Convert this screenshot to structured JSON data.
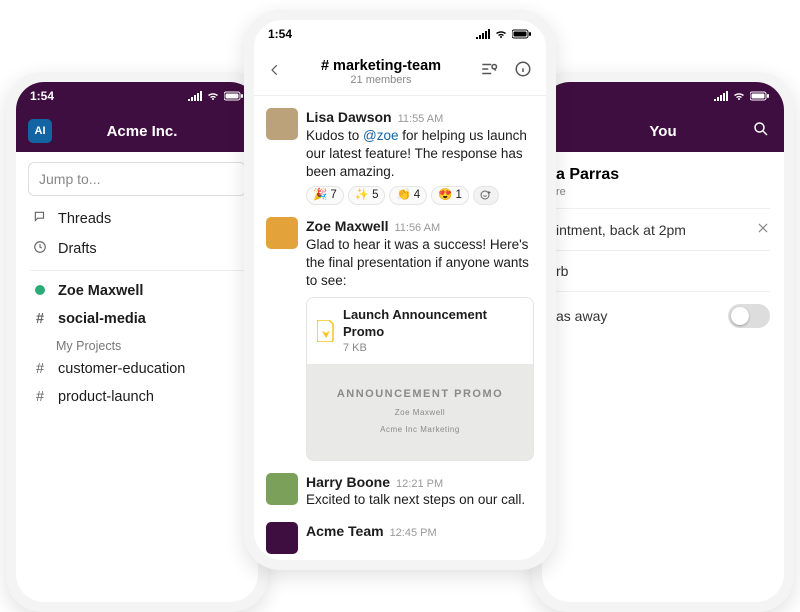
{
  "status": {
    "time": "1:54"
  },
  "left": {
    "workspace_icon_text": "AI",
    "workspace_name": "Acme Inc.",
    "search_placeholder": "Jump to...",
    "nav": {
      "threads": "Threads",
      "drafts": "Drafts"
    },
    "items": [
      {
        "label": "Zoe Maxwell",
        "kind": "dm",
        "bold": true
      },
      {
        "label": "social-media",
        "kind": "channel",
        "bold": true
      }
    ],
    "section_heading": "My Projects",
    "items2": [
      {
        "label": "customer-education",
        "kind": "channel",
        "bold": false
      },
      {
        "label": "product-launch",
        "kind": "channel",
        "bold": false
      }
    ]
  },
  "right": {
    "header": "You",
    "user_name_fragment": "a Parras",
    "rows": {
      "status_text": "intment, back at 2pm",
      "edit_text": "rb",
      "away_label": "as away"
    }
  },
  "center": {
    "channel": "# marketing-team",
    "members": "21 members",
    "messages": [
      {
        "author": "Lisa Dawson",
        "time": "11:55 AM",
        "avatar_color": "#bba27a",
        "text_before": "Kudos to ",
        "mention": "@zoe",
        "text_after": " for helping us launch our latest feature! The response has been amazing.",
        "reactions": [
          {
            "emoji": "🎉",
            "count": "7"
          },
          {
            "emoji": "✨",
            "count": "5"
          },
          {
            "emoji": "👏",
            "count": "4"
          },
          {
            "emoji": "😍",
            "count": "1"
          }
        ]
      },
      {
        "author": "Zoe Maxwell",
        "time": "11:56 AM",
        "avatar_color": "#e3a23a",
        "text": "Glad to hear it was a success! Here's the final presentation if anyone wants to see:",
        "file": {
          "title": "Launch Announcement Promo",
          "size": "7 KB",
          "preview_title": "ANNOUNCEMENT PROMO",
          "preview_line1": "Zoe Maxwell",
          "preview_line2": "Acme Inc Marketing"
        }
      },
      {
        "author": "Harry Boone",
        "time": "12:21 PM",
        "avatar_color": "#7aa05a",
        "text": "Excited to talk next steps on our call."
      },
      {
        "author": "Acme Team",
        "time": "12:45 PM",
        "avatar_color": "#3f0e40",
        "text": ""
      }
    ]
  }
}
